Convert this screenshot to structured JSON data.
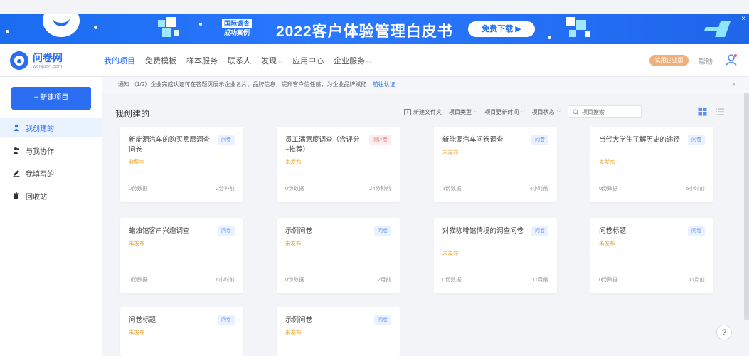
{
  "banner": {
    "case_tag_line1": "国际调查",
    "case_tag_line2": "成功案例",
    "headline": "2022客户体验管理白皮书",
    "download_label": "免费下载 ▶",
    "close_label": "×"
  },
  "nav": {
    "logo_name": "问卷网",
    "logo_domain": "wenjuan.com",
    "items": [
      {
        "label": "我的项目",
        "active": true,
        "dropdown": false
      },
      {
        "label": "免费模板",
        "active": false,
        "dropdown": false
      },
      {
        "label": "样本服务",
        "active": false,
        "dropdown": false
      },
      {
        "label": "联系人",
        "active": false,
        "dropdown": false
      },
      {
        "label": "发现",
        "active": false,
        "dropdown": true
      },
      {
        "label": "应用中心",
        "active": false,
        "dropdown": false
      },
      {
        "label": "企业服务",
        "active": false,
        "dropdown": true
      }
    ],
    "trial_label": "试用企业版",
    "help_label": "帮助"
  },
  "sidebar": {
    "new_project_label": "+ 新建项目",
    "items": [
      {
        "label": "我创建的",
        "icon": "user-icon",
        "active": true
      },
      {
        "label": "与我协作",
        "icon": "users-icon",
        "active": false
      },
      {
        "label": "我填写的",
        "icon": "pen-icon",
        "active": false
      },
      {
        "label": "回收站",
        "icon": "trash-icon",
        "active": false
      }
    ]
  },
  "notice": {
    "text": "通知 （1/2）企业完成认证可在答题页展示企业名片、品牌信息，提升客户信任感，为企业品牌赋能",
    "link_label": "前往认证",
    "close_label": "×"
  },
  "main": {
    "title": "我创建的",
    "toolbar": {
      "new_folder_label": "新建文件夹",
      "filter_type_label": "项目类型",
      "filter_time_label": "项目更新时间",
      "filter_status_label": "项目状态",
      "search_placeholder": "项目搜索"
    },
    "cards": [
      {
        "title": "新能源汽车的购买意愿调查问卷",
        "type": "问卷",
        "type_color": "blue",
        "status": "收集中",
        "data_count": "0份数据",
        "time": "2分钟前"
      },
      {
        "title": "员工满意度调查（含评分+推荐）",
        "type": "测评卷",
        "type_color": "red",
        "status": "未发布",
        "data_count": "0份数据",
        "time": "24分钟前"
      },
      {
        "title": "新能源汽车问卷调查",
        "type": "问卷",
        "type_color": "blue",
        "status": "未发布",
        "data_count": "1份数据",
        "time": "4小时前"
      },
      {
        "title": "当代大学生了解历史的途径",
        "type": "问卷",
        "type_color": "blue",
        "status": "未发布",
        "data_count": "0份数据",
        "time": "5小时前"
      },
      {
        "title": "蜡烛馆客户兴趣调查",
        "type": "问卷",
        "type_color": "blue",
        "status": "未发布",
        "data_count": "0份数据",
        "time": "6小时前"
      },
      {
        "title": "示例问卷",
        "type": "问卷",
        "type_color": "blue",
        "status": "未发布",
        "data_count": "0份数据",
        "time": "2月前"
      },
      {
        "title": "对猫咖啡馆情境的调查问卷",
        "type": "问卷",
        "type_color": "blue",
        "status": "未发布",
        "data_count": "0份数据",
        "time": "11月前"
      },
      {
        "title": "问卷标题",
        "type": "问卷",
        "type_color": "blue",
        "status": "未发布",
        "data_count": "0份数据",
        "time": "11月前"
      },
      {
        "title": "问卷标题",
        "type": "问卷",
        "type_color": "blue",
        "status": "未发布",
        "data_count": "",
        "time": ""
      },
      {
        "title": "示例问卷",
        "type": "问卷",
        "type_color": "blue",
        "status": "未发布",
        "data_count": "",
        "time": ""
      }
    ]
  },
  "help_fab_label": "?",
  "colors": {
    "accent": "#2c6ef2",
    "status_collecting": "#f0a020",
    "status_unpublished": "#f0a020",
    "trial_badge": "#f0b07a"
  }
}
